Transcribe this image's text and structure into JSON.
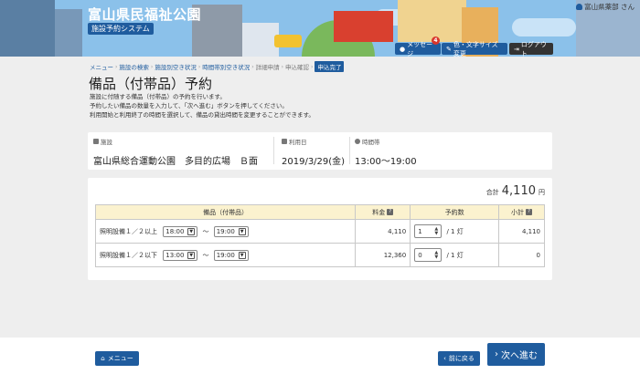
{
  "header": {
    "site_title": "富山県民福祉公園",
    "system_label": "施設予約システム",
    "user": "富山県薬部 さん",
    "message_label": "メッセージ",
    "message_count": "4",
    "color_label": "色・文字サイズ変更",
    "logout_label": "ログアウト"
  },
  "breadcrumb": [
    "メニュー",
    "施設の検索",
    "施設別空き状況",
    "時間帯別空き状況",
    "詳細申請",
    "申込確認",
    "申込完了"
  ],
  "page": {
    "title": "備品（付帯品）予約",
    "desc": [
      "施設に付随する備品（付帯品）の予約を行います。",
      "予約したい備品の数量を入力して、「次へ進む」ボタンを押してください。",
      "利用開始と利用終了の時間を選択して、備品の貸出時間を変更することができます。"
    ]
  },
  "info": {
    "facility_label": "施設",
    "facility_value": "富山県総合運動公園　多目的広場　Ｂ面",
    "date_label": "利用日",
    "date_value": "2019/3/29(金)",
    "time_label": "時間帯",
    "time_value": "13:00〜19:00"
  },
  "total": {
    "label": "合計",
    "value": "4,110",
    "unit": "円"
  },
  "table": {
    "headers": [
      "備品（付帯品）",
      "料金",
      "予約数",
      "小計"
    ],
    "help_mark": "?",
    "tilde": "〜",
    "rows": [
      {
        "name": "照明設備１／２以上",
        "start": "18:00",
        "end": "19:00",
        "price": "4,110",
        "qty": "1",
        "unit": "/ 1 灯",
        "subtotal": "4,110"
      },
      {
        "name": "照明設備１／２以下",
        "start": "13:00",
        "end": "19:00",
        "price": "12,360",
        "qty": "0",
        "unit": "/ 1 灯",
        "subtotal": "0"
      }
    ]
  },
  "footer": {
    "menu_label": "メニュー",
    "back_label": "前に戻る",
    "next_label": "次へ進む"
  }
}
